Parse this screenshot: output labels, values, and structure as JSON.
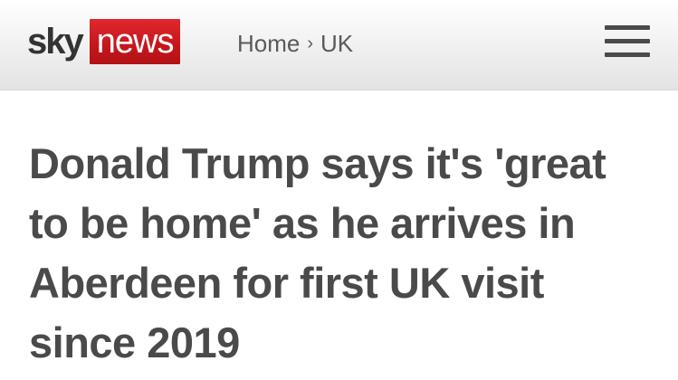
{
  "header": {
    "logo": {
      "sky": "sky",
      "news": "news"
    },
    "breadcrumb": {
      "home": "Home",
      "separator": "›",
      "section": "UK"
    },
    "menu_icon": "hamburger-menu-icon"
  },
  "article": {
    "headline": "Donald Trump says it's 'great to be home' as he arrives in Aberdeen for first UK visit since 2019"
  },
  "colors": {
    "brand_red": "#c4161c",
    "headline_text": "#4a4a4a",
    "header_gray": "#e3e3e3"
  }
}
